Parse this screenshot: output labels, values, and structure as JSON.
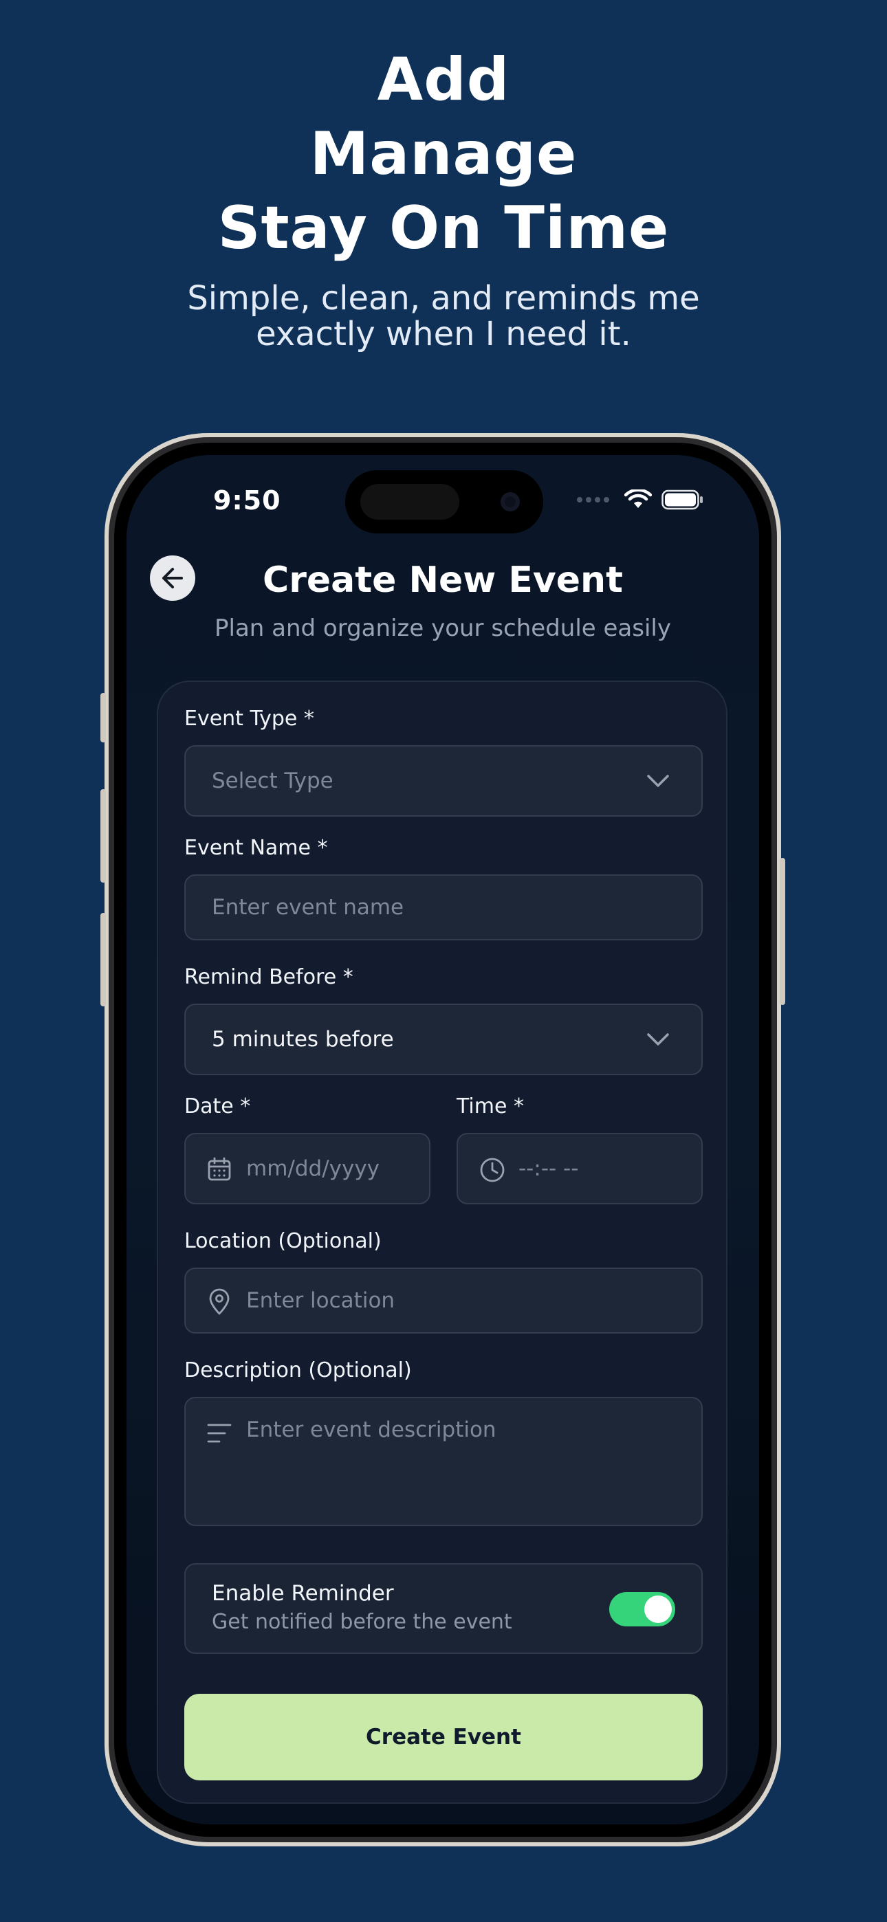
{
  "marketing": {
    "headline": [
      "Add",
      "Manage",
      "Stay On Time"
    ],
    "tagline": [
      "Simple, clean, and reminds me",
      "exactly when I need it."
    ]
  },
  "status_bar": {
    "time": "9:50",
    "icons": [
      "signal-dots-icon",
      "wifi-icon",
      "battery-icon"
    ]
  },
  "header": {
    "back_icon": "arrow-left-icon",
    "title": "Create New Event",
    "subtitle": "Plan and organize your schedule easily"
  },
  "form": {
    "event_type": {
      "label": "Event Type *",
      "placeholder": "Select Type"
    },
    "event_name": {
      "label": "Event Name *",
      "placeholder": "Enter event name"
    },
    "remind_before": {
      "label": "Remind Before *",
      "value": "5 minutes before"
    },
    "date": {
      "label": "Date *",
      "placeholder": "mm/dd/yyyy"
    },
    "time": {
      "label": "Time *",
      "placeholder": "--:-- --"
    },
    "location": {
      "label": "Location (Optional)",
      "placeholder": "Enter location"
    },
    "description": {
      "label": "Description (Optional)",
      "placeholder": "Enter event description"
    },
    "reminder": {
      "title": "Enable Reminder",
      "subtitle": "Get notified before the event",
      "enabled": true
    },
    "submit_label": "Create Event"
  },
  "colors": {
    "background": "#0f3157",
    "screen": "#0a1628",
    "card": "#131c2e",
    "field": "#1e2738",
    "toggle_on": "#35d47a",
    "button": "#c9eaa8"
  }
}
